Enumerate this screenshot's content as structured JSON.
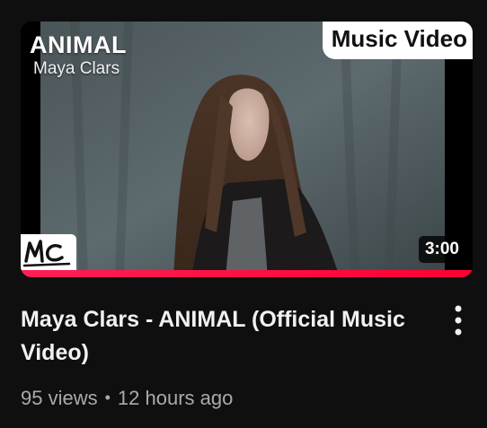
{
  "video": {
    "thumbnail": {
      "overlay_title": "ANIMAL",
      "overlay_artist": "Maya Clars",
      "tag_banner": "Music Video",
      "logo_text": "MC",
      "duration": "3:00",
      "watched_progress": 1.0
    },
    "title": "Maya Clars - ANIMAL (Official Music Video)",
    "views": "95 views",
    "separator": "•",
    "published": "12 hours ago"
  },
  "icons": {
    "menu": "more-vert-icon",
    "logo": "channel-logo-icon"
  },
  "colors": {
    "background": "#0f0f0f",
    "progress": "#ff0033",
    "title": "#f1f1f1",
    "meta": "#aaaaaa"
  }
}
